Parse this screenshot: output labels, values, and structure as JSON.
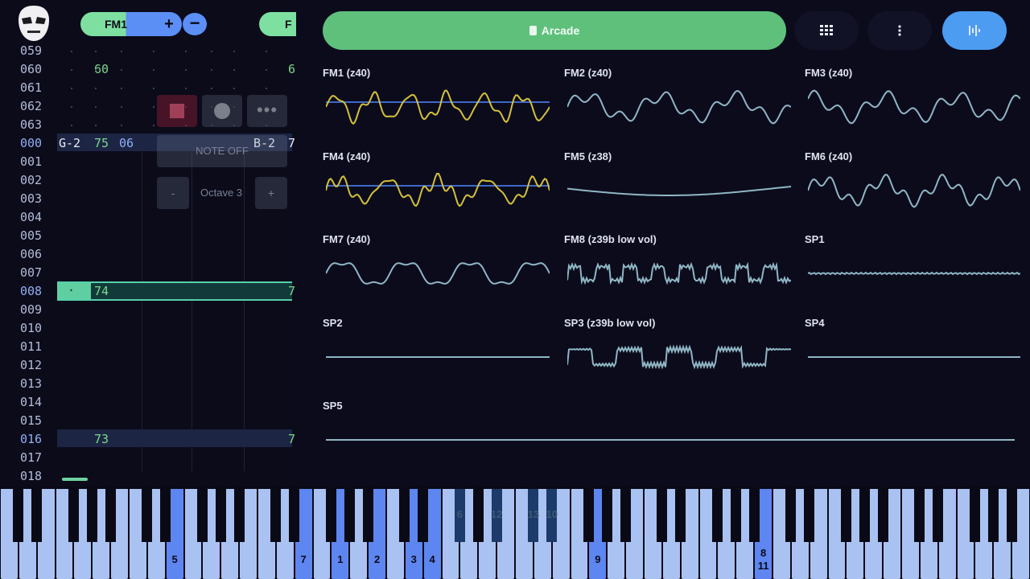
{
  "tracker": {
    "channel_pill_label": "FM1",
    "next_channel_label": "F",
    "plus_label": "+",
    "minus_label": "−",
    "rows": [
      "059",
      "060",
      "061",
      "062",
      "063",
      "000",
      "001",
      "002",
      "003",
      "004",
      "005",
      "006",
      "007",
      "008",
      "009",
      "010",
      "011",
      "012",
      "013",
      "014",
      "015",
      "016",
      "017",
      "018"
    ],
    "row_060_value": "60",
    "row_060_extra": "6",
    "row_000": {
      "note": "G-2",
      "volume": "75",
      "instrument": "06",
      "note2": "B-2",
      "extra": "7"
    },
    "row_008": {
      "dot": "·",
      "value": "74",
      "extra": "7"
    },
    "row_016": {
      "value": "73",
      "extra": "7"
    },
    "note_off_label": "NOTE OFF",
    "octave_label": "Octave 3",
    "octave_minus": "-",
    "octave_plus": "+",
    "more_label": "•••"
  },
  "song_button_label": "Arcade",
  "scopes": [
    {
      "name": "FM1 (z40)",
      "wave": "fm1"
    },
    {
      "name": "FM2 (z40)",
      "wave": "fm2"
    },
    {
      "name": "FM3 (z40)",
      "wave": "fm3"
    },
    {
      "name": "FM4 (z40)",
      "wave": "fm4"
    },
    {
      "name": "FM5 (z38)",
      "wave": "fm5"
    },
    {
      "name": "FM6 (z40)",
      "wave": "fm6"
    },
    {
      "name": "FM7 (z40)",
      "wave": "fm7"
    },
    {
      "name": "FM8 (z39b low vol)",
      "wave": "fm8"
    },
    {
      "name": "SP1",
      "wave": "sp1"
    },
    {
      "name": "SP2",
      "wave": "flat"
    },
    {
      "name": "SP3 (z39b low vol)",
      "wave": "sp3"
    },
    {
      "name": "SP4",
      "wave": "flat"
    },
    {
      "name": "SP5",
      "wave": "flat"
    }
  ],
  "colors": {
    "accent_green": "#5fc07c",
    "accent_blue": "#4c9cf2",
    "scope_yellow": "#d4c03a",
    "scope_blue": "#3f68c8",
    "scope_teal": "#8fb6c4"
  },
  "piano": {
    "labels": {
      "k5": "5",
      "k7": "7",
      "k1": "1",
      "k2": "2",
      "k3": "3",
      "k4": "4",
      "k9": "9",
      "k8": "8",
      "k11": "11",
      "b6": "6",
      "b12": "12",
      "b13": "13",
      "b10": "10"
    }
  }
}
